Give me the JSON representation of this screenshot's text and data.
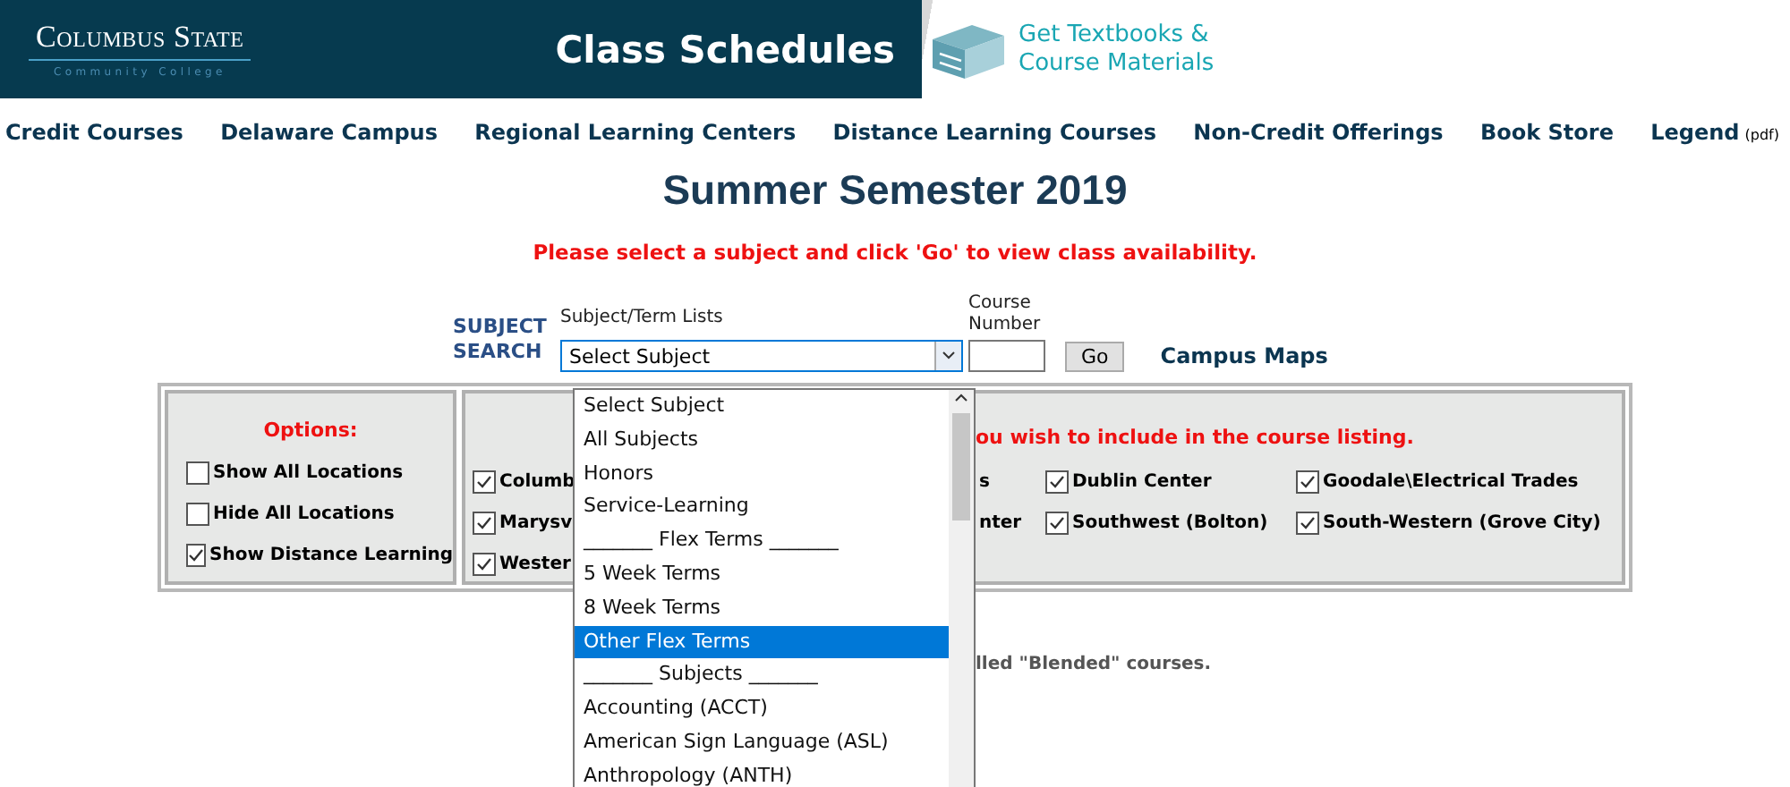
{
  "header": {
    "logo": {
      "name": "Columbus State",
      "subtitle": "Community College"
    },
    "title": "Class Schedules",
    "textbook_link": "Get Textbooks & Course Materials"
  },
  "nav": [
    {
      "label": "Credit Courses"
    },
    {
      "label": "Delaware Campus"
    },
    {
      "label": "Regional Learning Centers"
    },
    {
      "label": "Distance Learning Courses"
    },
    {
      "label": "Non-Credit Offerings"
    },
    {
      "label": "Book Store"
    },
    {
      "label": "Legend",
      "suffix": "(pdf)"
    }
  ],
  "page_title": "Summer Semester 2019",
  "message": "Please select a subject and click 'Go' to view class availability.",
  "search": {
    "heading": "SUBJECT SEARCH",
    "subject_label": "Subject/Term Lists",
    "select_value": "Select Subject",
    "expanded": true,
    "course_number_label": "Course Number",
    "go_button": "Go",
    "campus_maps": "Campus Maps"
  },
  "options": {
    "title": "Options:",
    "items": [
      {
        "label": "Show All Locations",
        "checked": false
      },
      {
        "label": "Hide All Locations",
        "checked": false
      },
      {
        "label": "Show Distance Learning",
        "checked": true
      }
    ]
  },
  "locations": {
    "heading": "ou wish to include in the course listing.",
    "rows": [
      [
        {
          "kind": "check",
          "label": "Columb",
          "checked": true
        },
        {
          "kind": "fragment",
          "label": "s"
        },
        {
          "kind": "check",
          "label": "Dublin Center",
          "checked": true
        },
        {
          "kind": "check",
          "label": "Goodale\\Electrical Trades",
          "checked": true
        }
      ],
      [
        {
          "kind": "check",
          "label": "Marysv",
          "checked": true
        },
        {
          "kind": "fragment",
          "label": "nter"
        },
        {
          "kind": "check",
          "label": "Southwest (Bolton)",
          "checked": true
        },
        {
          "kind": "check",
          "label": "South-Western (Grove City)",
          "checked": true
        }
      ],
      [
        {
          "kind": "check",
          "label": "Wester",
          "checked": true
        }
      ]
    ]
  },
  "note": "lled \"Blended\" courses.",
  "dropdown": {
    "items": [
      {
        "label": "Select Subject",
        "selected": false
      },
      {
        "label": "All Subjects",
        "selected": false
      },
      {
        "label": "Honors",
        "selected": false
      },
      {
        "label": "Service-Learning",
        "selected": false
      },
      {
        "label": "_______ Flex Terms _______",
        "selected": false
      },
      {
        "label": "5 Week Terms",
        "selected": false
      },
      {
        "label": "8 Week Terms",
        "selected": false
      },
      {
        "label": "Other Flex Terms",
        "selected": true
      },
      {
        "label": "_______ Subjects _______",
        "selected": false
      },
      {
        "label": "Accounting (ACCT)",
        "selected": false
      },
      {
        "label": "American Sign Language (ASL)",
        "selected": false
      },
      {
        "label": "Anthropology (ANTH)",
        "selected": false
      }
    ]
  }
}
